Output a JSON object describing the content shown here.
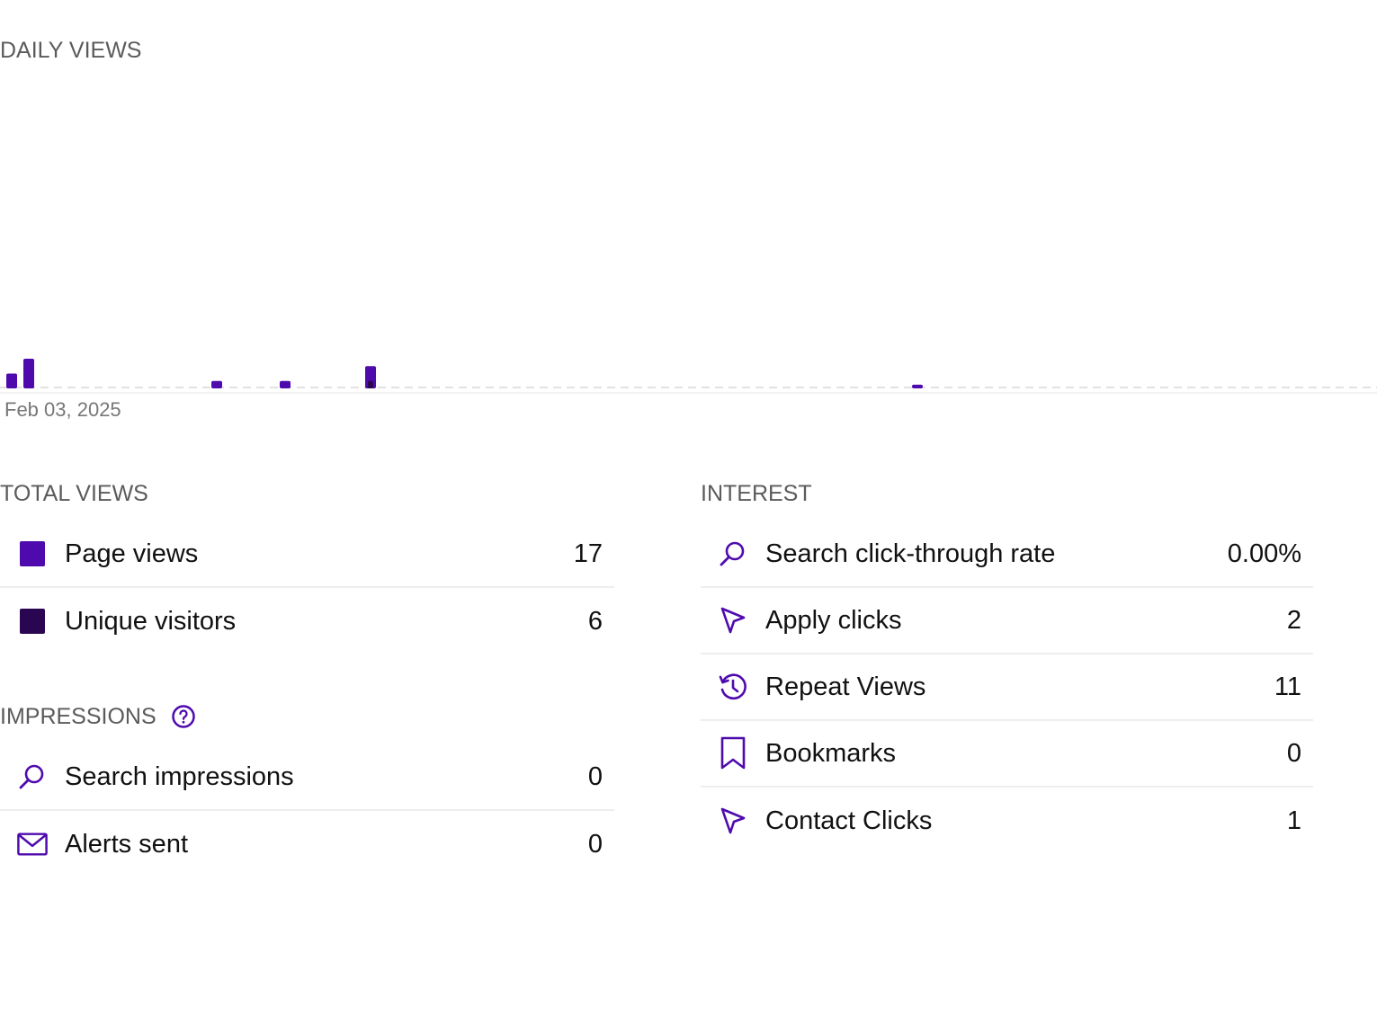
{
  "daily_views": {
    "title": "DAILY VIEWS",
    "date_label": "Feb 03, 2025"
  },
  "chart_data": {
    "type": "bar",
    "title": "DAILY VIEWS",
    "x_start_label": "Feb 03, 2025",
    "days": 80,
    "series": [
      {
        "name": "Page views",
        "color": "#4f0aae",
        "values": {
          "0": 2,
          "1": 4,
          "12": 1,
          "16": 1,
          "21": 3,
          "53": 0.5
        }
      },
      {
        "name": "Unique visitors",
        "color": "#2a0652",
        "values": {
          "21": 1
        }
      }
    ],
    "ylim": [
      0,
      40
    ],
    "grid": false
  },
  "total_views": {
    "title": "TOTAL VIEWS",
    "rows": [
      {
        "label": "Page views",
        "value": "17",
        "swatch_color": "#4f0aae"
      },
      {
        "label": "Unique visitors",
        "value": "6",
        "swatch_color": "#2a0652"
      }
    ]
  },
  "impressions": {
    "title": "IMPRESSIONS",
    "help_icon": "help-circle-icon",
    "rows": [
      {
        "label": "Search impressions",
        "value": "0",
        "icon": "search-icon"
      },
      {
        "label": "Alerts sent",
        "value": "0",
        "icon": "envelope-icon"
      }
    ]
  },
  "interest": {
    "title": "INTEREST",
    "rows": [
      {
        "label": "Search click-through rate",
        "value": "0.00%",
        "icon": "search-icon"
      },
      {
        "label": "Apply clicks",
        "value": "2",
        "icon": "cursor-arrow-icon"
      },
      {
        "label": "Repeat Views",
        "value": "11",
        "icon": "history-clock-icon"
      },
      {
        "label": "Bookmarks",
        "value": "0",
        "icon": "bookmark-icon"
      },
      {
        "label": "Contact Clicks",
        "value": "1",
        "icon": "cursor-arrow-icon"
      }
    ]
  },
  "colors": {
    "accent": "#4f0aae",
    "accent_dark": "#2a0652",
    "divider": "#eeeeee"
  }
}
